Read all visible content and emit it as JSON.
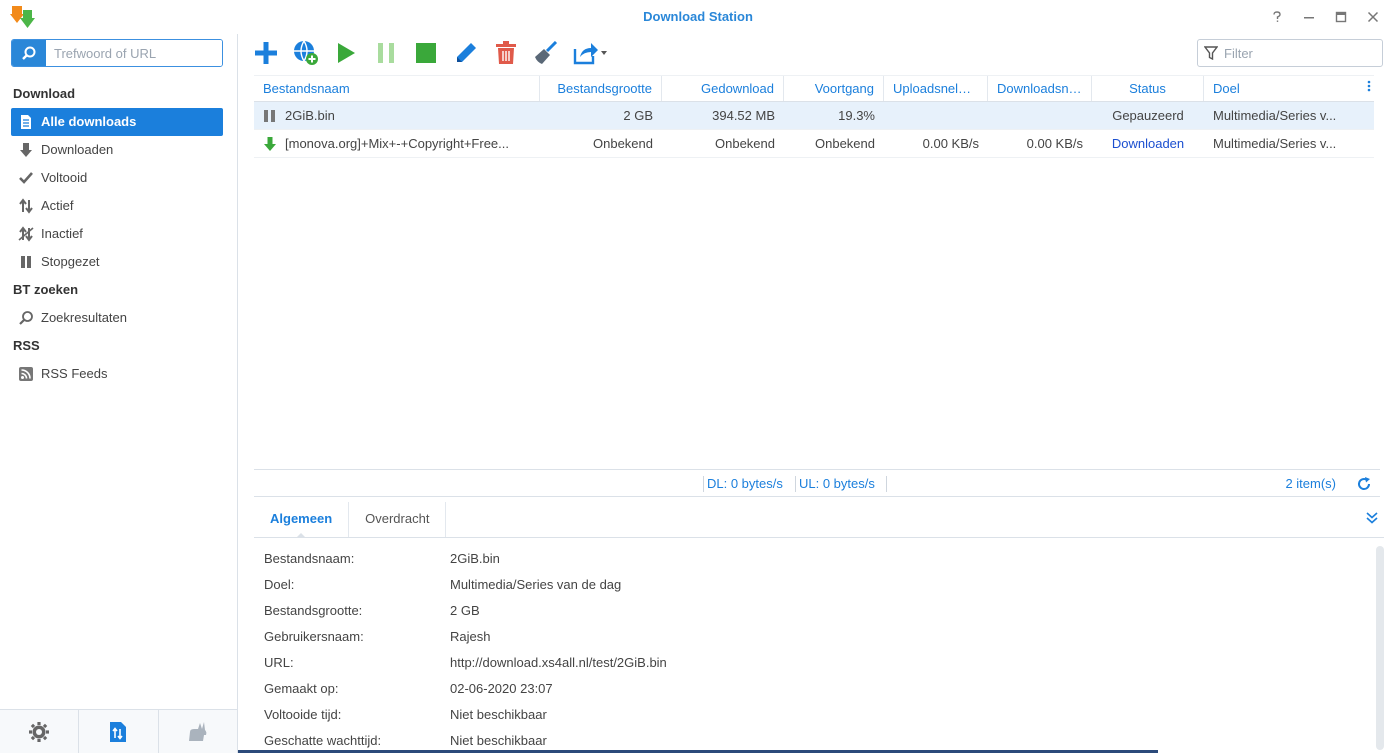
{
  "window": {
    "title": "Download Station"
  },
  "sidebar": {
    "search_placeholder": "Trefwoord of URL",
    "sections": {
      "download": "Download",
      "bt": "BT zoeken",
      "rss": "RSS"
    },
    "items": {
      "all": "Alle downloads",
      "downloading": "Downloaden",
      "completed": "Voltooid",
      "active": "Actief",
      "inactive": "Inactief",
      "stopped": "Stopgezet",
      "search_results": "Zoekresultaten",
      "rss_feeds": "RSS Feeds"
    }
  },
  "toolbar": {
    "filter_placeholder": "Filter"
  },
  "grid": {
    "columns": [
      "Bestandsnaam",
      "Bestandsgrootte",
      "Gedownload",
      "Voortgang",
      "Uploadsnelh…",
      "Downloadsn…",
      "Status",
      "Doel"
    ],
    "rows": [
      {
        "name": "2GiB.bin",
        "size": "2 GB",
        "downloaded": "394.52 MB",
        "progress": "19.3%",
        "upload": "",
        "download": "",
        "status": "Gepauzeerd",
        "dest": "Multimedia/Series v..."
      },
      {
        "name": "[monova.org]+Mix+-+Copyright+Free...",
        "size": "Onbekend",
        "downloaded": "Onbekend",
        "progress": "Onbekend",
        "upload": "0.00 KB/s",
        "download": "0.00 KB/s",
        "status": "Downloaden",
        "dest": "Multimedia/Series v..."
      }
    ]
  },
  "statusbar": {
    "dl": "DL:  0 bytes/s",
    "ul": "UL:  0 bytes/s",
    "count": "2 item(s)"
  },
  "details": {
    "tabs": [
      "Algemeen",
      "Overdracht"
    ],
    "fields": [
      {
        "label": "Bestandsnaam:",
        "value": "2GiB.bin"
      },
      {
        "label": "Doel:",
        "value": "Multimedia/Series van de dag"
      },
      {
        "label": "Bestandsgrootte:",
        "value": "2 GB"
      },
      {
        "label": "Gebruikersnaam:",
        "value": "Rajesh"
      },
      {
        "label": "URL:",
        "value": "http://download.xs4all.nl/test/2GiB.bin"
      },
      {
        "label": "Gemaakt op:",
        "value": "02-06-2020 23:07"
      },
      {
        "label": "Voltooide tijd:",
        "value": "Niet beschikbaar"
      },
      {
        "label": "Geschatte wachttijd:",
        "value": "Niet beschikbaar"
      }
    ]
  },
  "colors": {
    "accent": "#1b7fdc",
    "green": "#3aa83a",
    "red": "#e05a4a"
  }
}
